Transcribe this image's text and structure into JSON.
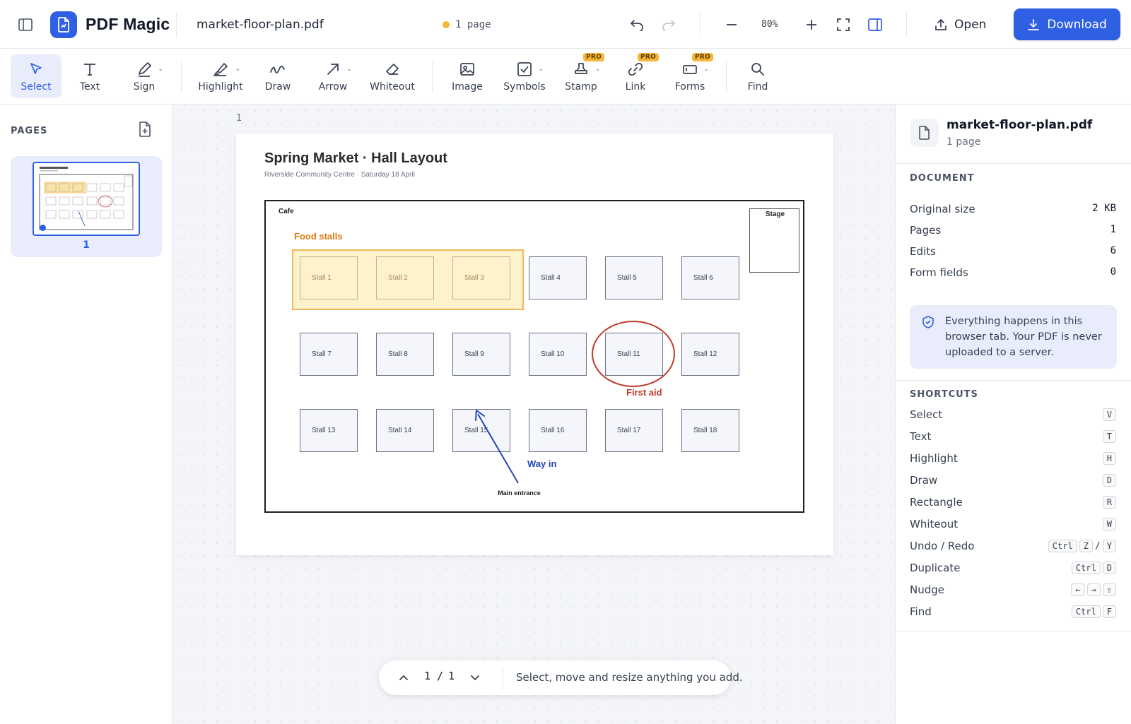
{
  "app": {
    "name": "PDF Magic",
    "file_name": "market-floor-plan.pdf",
    "page_count_label": "1 page",
    "zoom": "80%"
  },
  "topbar": {
    "open_label": "Open",
    "download_label": "Download"
  },
  "colors": {
    "accent": "#2f5fe3",
    "pro_badge": "#f4b63a",
    "annotation_red": "#c0392b",
    "annotation_blue": "#2446b5",
    "highlight_orange": "#e07b12"
  },
  "toolbar": {
    "tools": [
      {
        "label": "Select",
        "icon": "cursor-icon",
        "active": true
      },
      {
        "label": "Text",
        "icon": "text-icon"
      },
      {
        "label": "Sign",
        "icon": "pen-icon",
        "has_menu": true
      },
      {
        "label": "Highlight",
        "icon": "highlighter-icon",
        "has_menu": true
      },
      {
        "label": "Draw",
        "icon": "squiggle-icon"
      },
      {
        "label": "Arrow",
        "icon": "arrow-icon",
        "has_menu": true
      },
      {
        "label": "Whiteout",
        "icon": "eraser-icon"
      },
      {
        "label": "Image",
        "icon": "image-icon"
      },
      {
        "label": "Symbols",
        "icon": "checkbox-icon",
        "has_menu": true
      },
      {
        "label": "Stamp",
        "icon": "stamp-icon",
        "badge": "PRO",
        "has_menu": true
      },
      {
        "label": "Link",
        "icon": "link-icon",
        "badge": "PRO"
      },
      {
        "label": "Forms",
        "icon": "form-icon",
        "badge": "PRO",
        "has_menu": true
      },
      {
        "label": "Find",
        "icon": "search-icon"
      }
    ]
  },
  "sidebar": {
    "title": "PAGES",
    "pages": [
      {
        "number": "1",
        "selected": true
      }
    ]
  },
  "canvas": {
    "page_label": "1"
  },
  "document": {
    "title": "Spring Market  ·  Hall Layout",
    "subtitle": "Riverside Community Centre  ·  Saturday 18 April",
    "cafe": "Cafe",
    "stage": "Stage",
    "food_zone": "Food stalls",
    "stalls": [
      "Stall 1",
      "Stall 2",
      "Stall 3",
      "Stall 4",
      "Stall 5",
      "Stall 6",
      "Stall 7",
      "Stall 8",
      "Stall 9",
      "Stall 10",
      "Stall 11",
      "Stall 12",
      "Stall 13",
      "Stall 14",
      "Stall 15",
      "Stall 16",
      "Stall 17",
      "Stall 18"
    ],
    "first_aid": "First aid",
    "way_in": "Way in",
    "entrance": "Main entrance"
  },
  "pager": {
    "current": "1",
    "separator": "/",
    "total": "1",
    "hint": "Select, move and resize anything you add."
  },
  "details": {
    "file_name": "market-floor-plan.pdf",
    "pages_label": "1 page",
    "section": "DOCUMENT",
    "rows": [
      {
        "label": "Original size",
        "value": "2 KB"
      },
      {
        "label": "Pages",
        "value": "1"
      },
      {
        "label": "Edits",
        "value": "6"
      },
      {
        "label": "Form fields",
        "value": "0"
      }
    ],
    "privacy_note": "Everything happens in this browser tab. Your PDF is never uploaded to a server."
  },
  "shortcuts": {
    "title": "SHORTCUTS",
    "items": [
      {
        "label": "Select",
        "keys": [
          "V"
        ]
      },
      {
        "label": "Text",
        "keys": [
          "T"
        ]
      },
      {
        "label": "Highlight",
        "keys": [
          "H"
        ]
      },
      {
        "label": "Draw",
        "keys": [
          "D"
        ]
      },
      {
        "label": "Rectangle",
        "keys": [
          "R"
        ]
      },
      {
        "label": "Whiteout",
        "keys": [
          "W"
        ]
      },
      {
        "label": "Undo / Redo",
        "keys": [
          "Ctrl",
          "Z",
          "/",
          "Y"
        ]
      },
      {
        "label": "Duplicate",
        "keys": [
          "Ctrl",
          "D"
        ]
      },
      {
        "label": "Nudge",
        "keys": [
          "←",
          "→",
          "⇧"
        ]
      },
      {
        "label": "Find",
        "keys": [
          "Ctrl",
          "F"
        ]
      }
    ]
  }
}
